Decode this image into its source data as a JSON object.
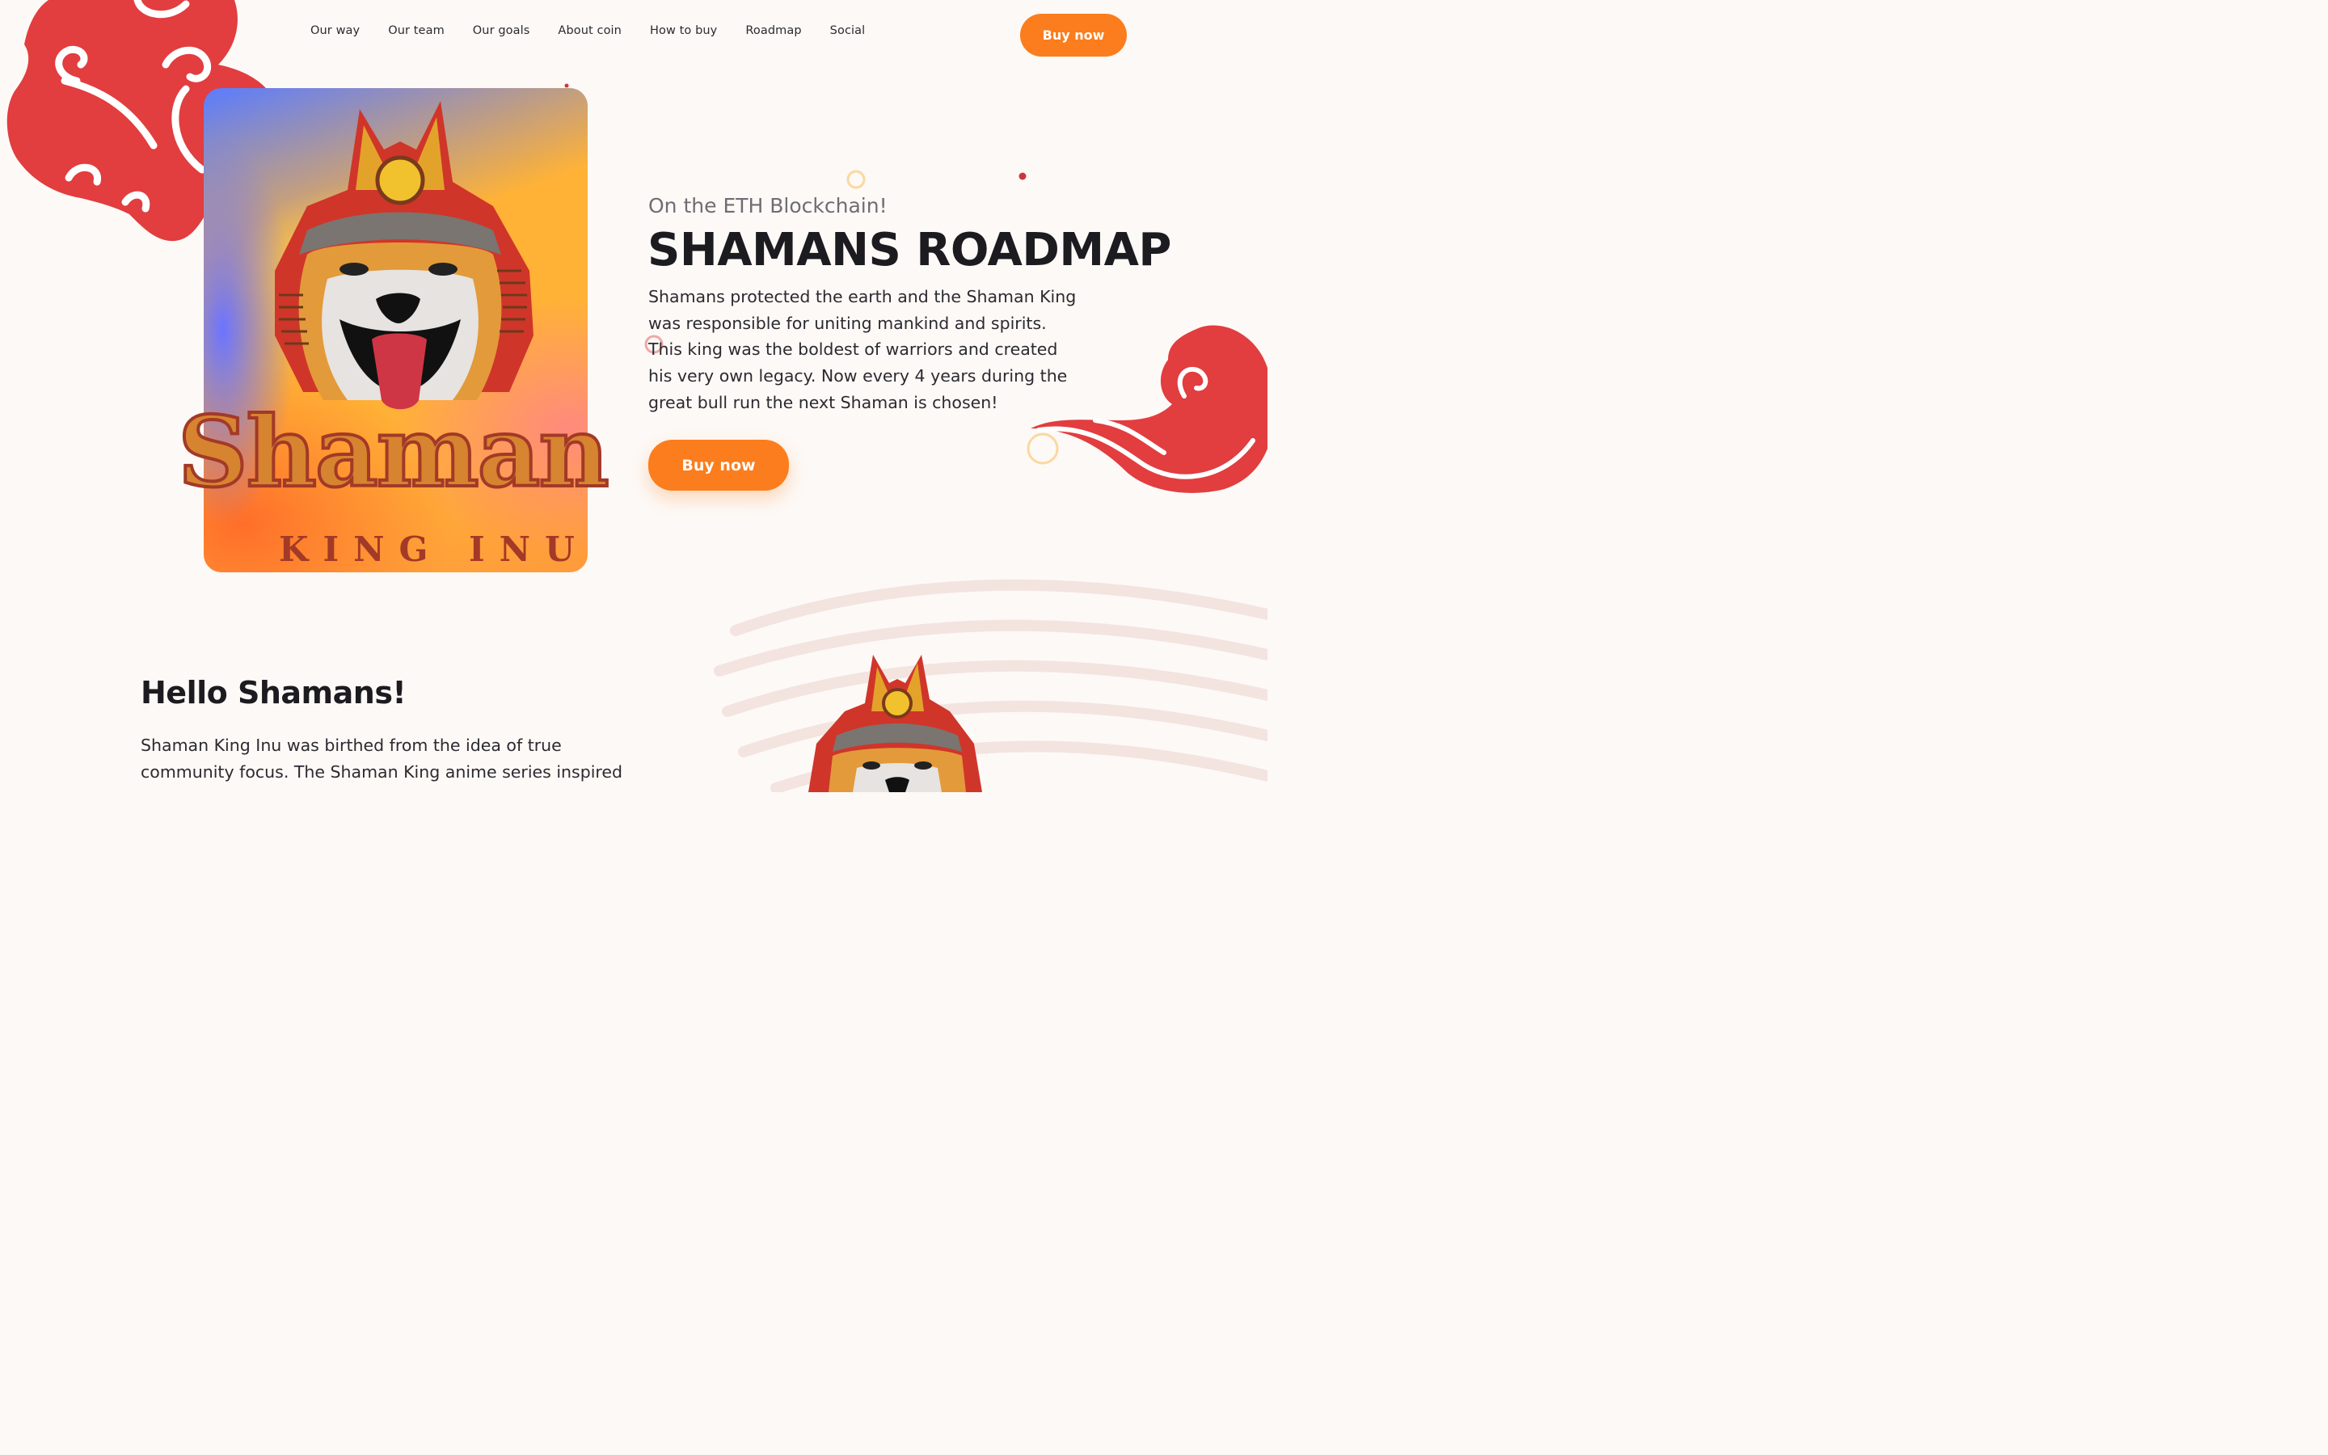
{
  "nav": {
    "items": [
      "Our way",
      "Our team",
      "Our goals",
      "About coin",
      "How to buy",
      "Roadmap",
      "Social"
    ],
    "cta": "Buy now"
  },
  "hero": {
    "eyebrow": "On the ETH Blockchain!",
    "title": "SHAMANS ROADMAP",
    "description": "Shamans protected the earth and the Shaman King was responsible for uniting mankind and spirits. This king was the boldest of warriors and created his very own legacy. Now every 4 years during the great bull run the next Shaman is chosen!",
    "cta": "Buy now",
    "logo_word": "Shaman",
    "logo_sub": "KING INU"
  },
  "intro": {
    "heading": "Hello Shamans!",
    "text": "Shaman King Inu was birthed from the idea of true community focus. The Shaman King anime series inspired"
  },
  "colors": {
    "accent": "#fb7d1d",
    "cloud": "#e23d3f",
    "background": "#fdf9f6"
  }
}
